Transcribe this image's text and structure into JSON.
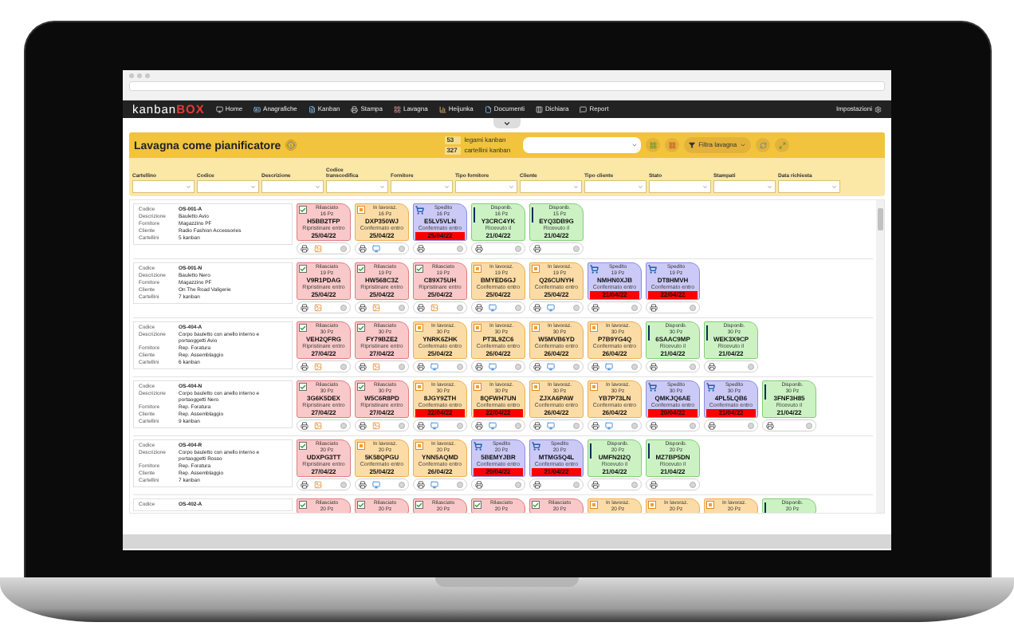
{
  "nav": {
    "logo_main": "kanban",
    "logo_accent": "BOX",
    "items": [
      {
        "label": "Home"
      },
      {
        "label": "Anagrafiche"
      },
      {
        "label": "Kanban"
      },
      {
        "label": "Stampa"
      },
      {
        "label": "Lavagna"
      },
      {
        "label": "Heijunka"
      },
      {
        "label": "Documenti"
      },
      {
        "label": "Dichiara"
      },
      {
        "label": "Report"
      }
    ],
    "settings": "Impostazioni"
  },
  "header": {
    "title": "Lavagna come pianificatore",
    "counts": [
      {
        "value": "53",
        "label": "legami kanban"
      },
      {
        "value": "327",
        "label": "cartellini kanban"
      }
    ],
    "filter_button": "Filtra lavagna"
  },
  "filters": [
    {
      "label": "Cartellino"
    },
    {
      "label": "Codice"
    },
    {
      "label": "Descrizione"
    },
    {
      "label": "Codice transcodifica"
    },
    {
      "label": "Fornitore"
    },
    {
      "label": "Tipo fornitore"
    },
    {
      "label": "Cliente"
    },
    {
      "label": "Tipo cliente"
    },
    {
      "label": "Stato"
    },
    {
      "label": "Stampati"
    },
    {
      "label": "Data richiesta"
    }
  ],
  "rows": [
    {
      "fields": [
        {
          "label": "Codice",
          "value": "OS-001-A"
        },
        {
          "label": "Descrizione",
          "value": "Bauletto Avio"
        },
        {
          "label": "Fornitore",
          "value": "Magazzino PF"
        },
        {
          "label": "Cliente",
          "value": "Radio Fashion Accessories"
        },
        {
          "label": "Cartellini",
          "value": "5 kanban"
        }
      ],
      "cards": [
        {
          "kind": "rilasciato",
          "status": "Rilasciato",
          "qty": "16 Pz",
          "code": "H5BB2TFP",
          "label": "Ripristinare entro",
          "date": "25/04/22",
          "overdue": false
        },
        {
          "kind": "lavorazione",
          "status": "In lavoraz.",
          "qty": "16 Pz",
          "code": "DXP350WJ",
          "label": "Confermato entro",
          "date": "25/04/22",
          "overdue": false
        },
        {
          "kind": "spedito",
          "status": "Spedito",
          "qty": "16 Pz",
          "code": "E5LV5VLN",
          "label": "Confermato entro",
          "date": "25/04/22",
          "overdue": true
        },
        {
          "kind": "disponibile",
          "status": "Disponib.",
          "qty": "16 Pz",
          "code": "Y3CRC4YK",
          "label": "Ricevuto il",
          "date": "21/04/22",
          "overdue": false
        },
        {
          "kind": "disponibile",
          "status": "Disponib.",
          "qty": "15 Pz",
          "code": "EYQ3DB9G",
          "label": "Ricevuto il",
          "date": "21/04/22",
          "overdue": false
        }
      ]
    },
    {
      "fields": [
        {
          "label": "Codice",
          "value": "OS-001-N"
        },
        {
          "label": "Descrizione",
          "value": "Bauletto Nero"
        },
        {
          "label": "Fornitore",
          "value": "Magazzino PF"
        },
        {
          "label": "Cliente",
          "value": "On The Road Valigerie"
        },
        {
          "label": "Cartellini",
          "value": "7 kanban"
        }
      ],
      "cards": [
        {
          "kind": "rilasciato",
          "status": "Rilasciato",
          "qty": "19 Pz",
          "code": "V9R1PDAG",
          "label": "Ripristinare entro",
          "date": "25/04/22",
          "overdue": false
        },
        {
          "kind": "rilasciato",
          "status": "Rilasciato",
          "qty": "19 Pz",
          "code": "HW568C3Z",
          "label": "Ripristinare entro",
          "date": "25/04/22",
          "overdue": false
        },
        {
          "kind": "rilasciato",
          "status": "Rilasciato",
          "qty": "19 Pz",
          "code": "C89X75UH",
          "label": "Ripristinare entro",
          "date": "25/04/22",
          "overdue": false
        },
        {
          "kind": "lavorazione",
          "status": "In lavoraz.",
          "qty": "19 Pz",
          "code": "BMYED6GJ",
          "label": "Confermato entro",
          "date": "25/04/22",
          "overdue": false
        },
        {
          "kind": "lavorazione",
          "status": "In lavoraz.",
          "qty": "19 Pz",
          "code": "Q26CUNYH",
          "label": "Confermato entro",
          "date": "25/04/22",
          "overdue": false
        },
        {
          "kind": "spedito",
          "status": "Spedito",
          "qty": "19 Pz",
          "code": "NMHN0XJB",
          "label": "Confermato entro",
          "date": "21/04/22",
          "overdue": true
        },
        {
          "kind": "spedito",
          "status": "Spedito",
          "qty": "19 Pz",
          "code": "DT8HMVH",
          "label": "Confermato entro",
          "date": "22/04/22",
          "overdue": true
        }
      ]
    },
    {
      "fields": [
        {
          "label": "Codice",
          "value": "OS-404-A"
        },
        {
          "label": "Descrizione",
          "value": "Corpo bauletto con anello interno e portaoggetti Avio"
        },
        {
          "label": "Fornitore",
          "value": "Rep. Foratura"
        },
        {
          "label": "Cliente",
          "value": "Rep. Assemblaggio"
        },
        {
          "label": "Cartellini",
          "value": "6 kanban"
        }
      ],
      "cards": [
        {
          "kind": "rilasciato",
          "status": "Rilasciato",
          "qty": "30 Pz",
          "code": "VEH2QFRG",
          "label": "Ripristinare entro",
          "date": "27/04/22",
          "overdue": false
        },
        {
          "kind": "rilasciato",
          "status": "Rilasciato",
          "qty": "30 Pz",
          "code": "FY79BZE2",
          "label": "Ripristinare entro",
          "date": "27/04/22",
          "overdue": false
        },
        {
          "kind": "lavorazione",
          "status": "In lavoraz.",
          "qty": "30 Pz",
          "code": "YNRK6ZHK",
          "label": "Confermato entro",
          "date": "25/04/22",
          "overdue": false
        },
        {
          "kind": "lavorazione",
          "status": "In lavoraz.",
          "qty": "30 Pz",
          "code": "PT3L9ZC6",
          "label": "Confermato entro",
          "date": "26/04/22",
          "overdue": false
        },
        {
          "kind": "lavorazione",
          "status": "In lavoraz.",
          "qty": "30 Pz",
          "code": "W5MVB6YD",
          "label": "Confermato entro",
          "date": "26/04/22",
          "overdue": false
        },
        {
          "kind": "lavorazione",
          "status": "In lavoraz.",
          "qty": "30 Pz",
          "code": "P7B9YG4Q",
          "label": "Confermato entro",
          "date": "26/04/22",
          "overdue": false
        },
        {
          "kind": "disponibile",
          "status": "Disponib.",
          "qty": "30 Pz",
          "code": "6SAAC9MP",
          "label": "Ricevuto il",
          "date": "21/04/22",
          "overdue": false
        },
        {
          "kind": "disponibile",
          "status": "Disponib.",
          "qty": "30 Pz",
          "code": "WEK3X9CP",
          "label": "Ricevuto il",
          "date": "21/04/22",
          "overdue": false
        }
      ]
    },
    {
      "fields": [
        {
          "label": "Codice",
          "value": "OS-404-N"
        },
        {
          "label": "Descrizione",
          "value": "Corpo bauletto con anello interno e portaoggetti Nero"
        },
        {
          "label": "Fornitore",
          "value": "Rep. Foratura"
        },
        {
          "label": "Cliente",
          "value": "Rep. Assemblaggio"
        },
        {
          "label": "Cartellini",
          "value": "9 kanban"
        }
      ],
      "cards": [
        {
          "kind": "rilasciato",
          "status": "Rilasciato",
          "qty": "30 Pz",
          "code": "3G6K5DEX",
          "label": "Ripristinare entro",
          "date": "27/04/22",
          "overdue": false
        },
        {
          "kind": "rilasciato",
          "status": "Rilasciato",
          "qty": "30 Pz",
          "code": "W5C6R8PD",
          "label": "Ripristinare entro",
          "date": "27/04/22",
          "overdue": false
        },
        {
          "kind": "lavorazione",
          "status": "In lavoraz.",
          "qty": "30 Pz",
          "code": "8JGY9ZTH",
          "label": "Confermato entro",
          "date": "22/04/22",
          "overdue": true
        },
        {
          "kind": "lavorazione",
          "status": "In lavoraz.",
          "qty": "30 Pz",
          "code": "8QFWH7UN",
          "label": "Confermato entro",
          "date": "22/04/22",
          "overdue": true
        },
        {
          "kind": "lavorazione",
          "status": "In lavoraz.",
          "qty": "30 Pz",
          "code": "ZJXA6PAW",
          "label": "Confermato entro",
          "date": "26/04/22",
          "overdue": false
        },
        {
          "kind": "lavorazione",
          "status": "In lavoraz.",
          "qty": "30 Pz",
          "code": "YB7P73LN",
          "label": "Confermato entro",
          "date": "26/04/22",
          "overdue": false
        },
        {
          "kind": "spedito",
          "status": "Spedito",
          "qty": "30 Pz",
          "code": "QMKJQ6AE",
          "label": "Confermato entro",
          "date": "20/04/22",
          "overdue": true
        },
        {
          "kind": "spedito",
          "status": "Spedito",
          "qty": "30 Pz",
          "code": "4PL5LQB6",
          "label": "Confermato entro",
          "date": "21/04/22",
          "overdue": true
        },
        {
          "kind": "disponibile",
          "status": "Disponib.",
          "qty": "30 Pz",
          "code": "3FNF3H85",
          "label": "Ricevuto il",
          "date": "21/04/22",
          "overdue": false
        }
      ]
    },
    {
      "fields": [
        {
          "label": "Codice",
          "value": "OS-404-R"
        },
        {
          "label": "Descrizione",
          "value": "Corpo bauletto con anello interno e portaoggetti Rosso"
        },
        {
          "label": "Fornitore",
          "value": "Rep. Foratura"
        },
        {
          "label": "Cliente",
          "value": "Rep. Assemblaggio"
        },
        {
          "label": "Cartellini",
          "value": "7 kanban"
        }
      ],
      "cards": [
        {
          "kind": "rilasciato",
          "status": "Rilasciato",
          "qty": "20 Pz",
          "code": "UDXPG3TT",
          "label": "Ripristinare entro",
          "date": "27/04/22",
          "overdue": false
        },
        {
          "kind": "lavorazione",
          "status": "In lavoraz.",
          "qty": "20 Pz",
          "code": "5K58QPGU",
          "label": "Confermato entro",
          "date": "25/04/22",
          "overdue": false
        },
        {
          "kind": "lavorazione",
          "status": "In lavoraz.",
          "qty": "20 Pz",
          "code": "YNN5AQMD",
          "label": "Confermato entro",
          "date": "26/04/22",
          "overdue": false
        },
        {
          "kind": "spedito",
          "status": "Spedito",
          "qty": "20 Pz",
          "code": "5BEMYJBR",
          "label": "Confermato entro",
          "date": "20/04/22",
          "overdue": true
        },
        {
          "kind": "spedito",
          "status": "Spedito",
          "qty": "20 Pz",
          "code": "MTMG5Q4L",
          "label": "Confermato entro",
          "date": "21/04/22",
          "overdue": true
        },
        {
          "kind": "disponibile",
          "status": "Disponib.",
          "qty": "20 Pz",
          "code": "UMFN2I2Q",
          "label": "Ricevuto il",
          "date": "21/04/22",
          "overdue": false
        },
        {
          "kind": "disponibile",
          "status": "Disponib.",
          "qty": "20 Pz",
          "code": "MZ7BP5DN",
          "label": "Ricevuto il",
          "date": "21/04/22",
          "overdue": false
        }
      ]
    },
    {
      "fields": [
        {
          "label": "Codice",
          "value": "OS-402-A"
        }
      ],
      "cards": [
        {
          "kind": "rilasciato",
          "status": "Rilasciato",
          "qty": "20 Pz"
        },
        {
          "kind": "rilasciato",
          "status": "Rilasciato",
          "qty": "20 Pz"
        },
        {
          "kind": "rilasciato",
          "status": "Rilasciato",
          "qty": "20 Pz"
        },
        {
          "kind": "rilasciato",
          "status": "Rilasciato",
          "qty": "20 Pz"
        },
        {
          "kind": "rilasciato",
          "status": "Rilasciato",
          "qty": "20 Pz"
        },
        {
          "kind": "lavorazione",
          "status": "In lavoraz.",
          "qty": "20 Pz"
        },
        {
          "kind": "lavorazione",
          "status": "In lavoraz.",
          "qty": "20 Pz"
        },
        {
          "kind": "lavorazione",
          "status": "In lavoraz.",
          "qty": "20 Pz"
        },
        {
          "kind": "disponibile",
          "status": "Disponib.",
          "qty": "20 Pz"
        }
      ]
    }
  ]
}
